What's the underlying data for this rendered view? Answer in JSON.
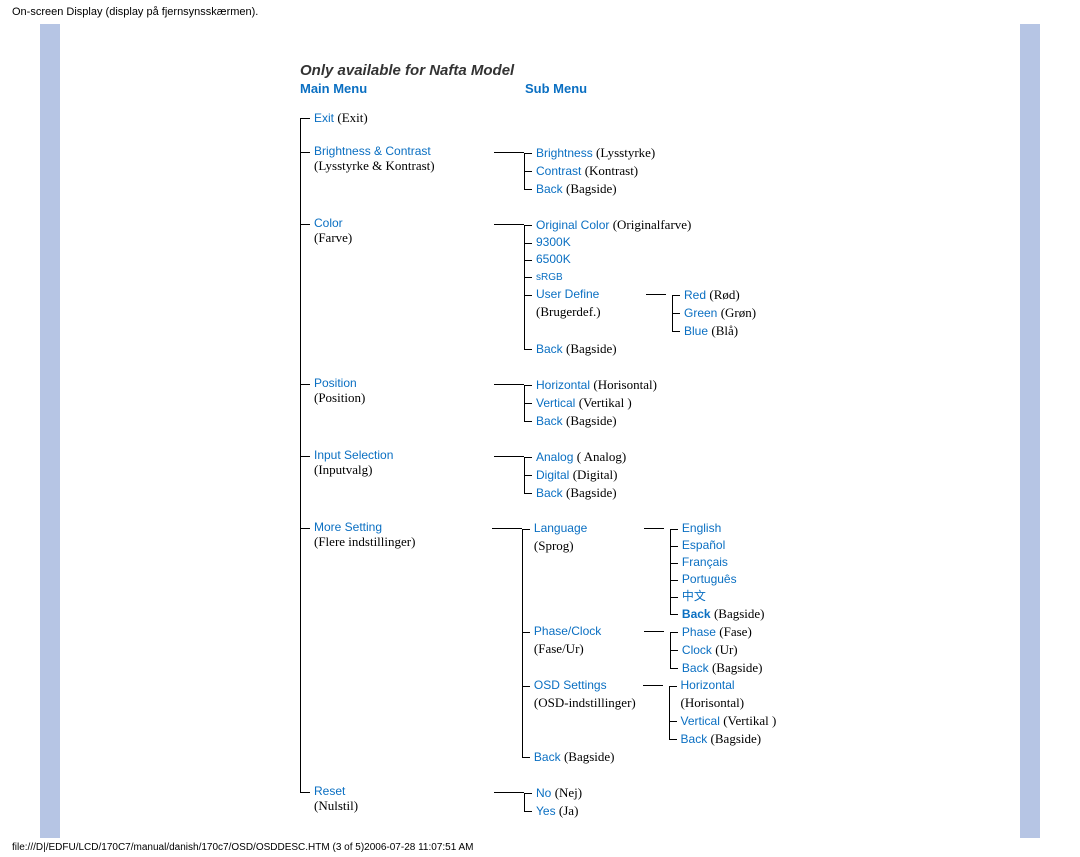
{
  "header": "On-screen Display (display på fjernsynsskærmen).",
  "footer": "file:///D|/EDFU/LCD/170C7/manual/danish/170c7/OSD/OSDDESC.HTM (3 of 5)2006-07-28 11:07:51 AM",
  "note": "Only available for Nafta Model",
  "cols": {
    "main": "Main Menu",
    "sub": "Sub Menu"
  },
  "menu": {
    "exit": {
      "t": "Exit",
      "p": "(Exit)"
    },
    "bc": {
      "t": "Brightness &  Contrast",
      "p": "(Lysstyrke & Kontrast)",
      "sub": [
        {
          "t": "Brightness",
          "p": "(Lysstyrke)"
        },
        {
          "t": "Contrast",
          "p": "(Kontrast)"
        },
        {
          "t": "Back",
          "p": "(Bagside)"
        }
      ]
    },
    "color": {
      "t": "Color",
      "p": "(Farve)",
      "sub": [
        {
          "t": "Original Color",
          "p": "(Originalfarve)"
        },
        {
          "t": "9300K",
          "p": ""
        },
        {
          "t": "6500K",
          "p": ""
        },
        {
          "t": "sRGB",
          "p": "",
          "small": true
        },
        {
          "t": "User Define",
          "p": "(Brugerdef.)",
          "sub": [
            {
              "t": "Red",
              "p": "(Rød)"
            },
            {
              "t": "Green",
              "p": "(Grøn)"
            },
            {
              "t": "Blue",
              "p": "(Blå)"
            }
          ]
        },
        {
          "t": "Back",
          "p": "(Bagside)"
        }
      ]
    },
    "pos": {
      "t": "Position",
      "p": "(Position)",
      "sub": [
        {
          "t": "Horizontal",
          "p": "(Horisontal)"
        },
        {
          "t": "Vertical",
          "p": "(Vertikal )"
        },
        {
          "t": "Back",
          "p": "(Bagside)"
        }
      ]
    },
    "inp": {
      "t": "Input Selection",
      "p": "(Inputvalg)",
      "sub": [
        {
          "t": "Analog",
          "p": "( Analog)"
        },
        {
          "t": "Digital",
          "p": "(Digital)"
        },
        {
          "t": "Back",
          "p": "(Bagside)"
        }
      ]
    },
    "more": {
      "t": "More Setting",
      "p": "(Flere indstillinger)",
      "sub": [
        {
          "t": "Language",
          "p": "(Sprog)",
          "sub": [
            {
              "t": "English",
              "p": ""
            },
            {
              "t": "Español",
              "p": ""
            },
            {
              "t": "Français",
              "p": ""
            },
            {
              "t": "Português",
              "p": ""
            },
            {
              "t": "中文",
              "p": ""
            },
            {
              "t": "Back",
              "p": "(Bagside)",
              "bold": true
            }
          ]
        },
        {
          "t": "Phase/Clock",
          "p": "(Fase/Ur)",
          "sub": [
            {
              "t": "Phase",
              "p": "(Fase)"
            },
            {
              "t": "Clock",
              "p": "(Ur)"
            },
            {
              "t": "Back",
              "p": "(Bagside)"
            }
          ]
        },
        {
          "t": "OSD Settings",
          "p": "(OSD-indstillinger)",
          "sub": [
            {
              "t": "Horizontal",
              "p": "(Horisontal)"
            },
            {
              "t": "Vertical",
              "p": "(Vertikal )"
            },
            {
              "t": "Back",
              "p": "(Bagside)"
            }
          ]
        },
        {
          "t": "Back",
          "p": "(Bagside)"
        }
      ]
    },
    "reset": {
      "t": "Reset",
      "p": "(Nulstil)",
      "sub": [
        {
          "t": "No",
          "p": "(Nej)"
        },
        {
          "t": "Yes",
          "p": "(Ja)"
        }
      ]
    }
  }
}
